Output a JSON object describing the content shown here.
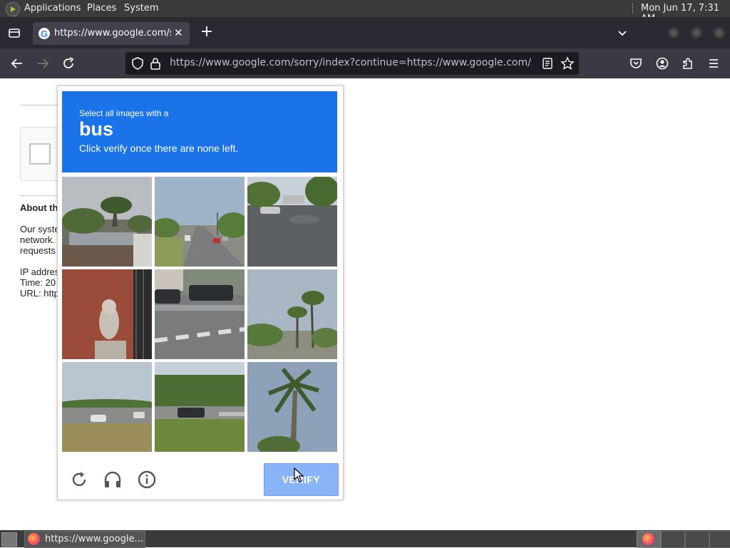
{
  "panel": {
    "menus": [
      "Applications",
      "Places",
      "System"
    ],
    "clock": "Mon Jun 17,  7:31 AM"
  },
  "browser": {
    "tab_title": "https://www.google.com/sorry/index?continue",
    "url": "https://www.google.com/sorry/index?continue=https://www.google.com/search%"
  },
  "page": {
    "about_heading": "About th",
    "body_lines": [
      "Our syste",
      "network.",
      "requests"
    ],
    "info_lines": [
      "IP addres",
      "Time: 20",
      "URL: http"
    ]
  },
  "captcha": {
    "instruction_prefix": "Select all images with a",
    "target": "bus",
    "instruction_suffix": "Click verify once there are none left.",
    "verify_label": "VERIFY",
    "tiles": [
      "houses-palm-trees",
      "road-with-cars",
      "parking-lot-car",
      "brick-wall-lion-statue",
      "crosswalk-pickup-truck",
      "palm-trees-street",
      "highway-car",
      "truck-by-trees",
      "tall-palm-tree"
    ]
  },
  "taskbar": {
    "window_label": "https://www.google..."
  },
  "colors": {
    "captcha_blue": "#1a73e8",
    "verify_disabled": "#8ab4f8",
    "browser_chrome": "#2b2a33"
  }
}
